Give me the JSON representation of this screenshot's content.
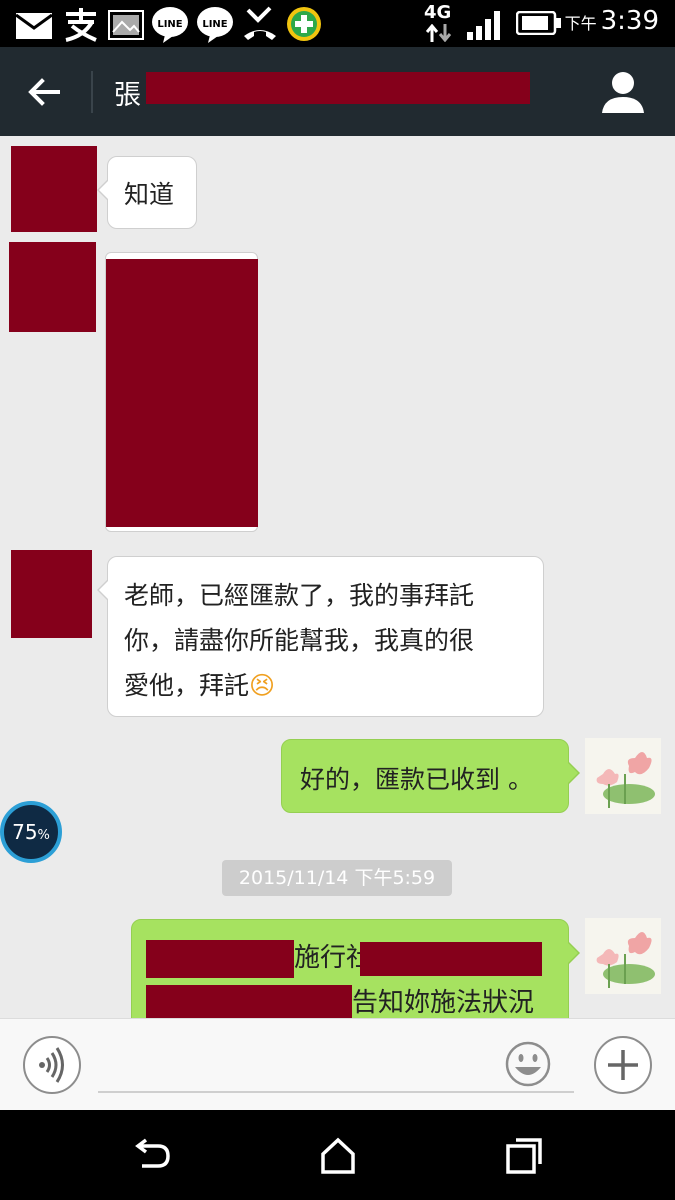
{
  "status_bar": {
    "network": "4G",
    "ampm": "下午",
    "time": "3:39",
    "icons": [
      "mail-icon",
      "alipay-icon",
      "image-icon",
      "line-icon",
      "line-icon",
      "missed-call-icon",
      "plus-app-icon",
      "signal-icon",
      "battery-icon"
    ]
  },
  "toolbar": {
    "title": "張",
    "back_icon": "arrow-left-icon",
    "profile_icon": "person-icon"
  },
  "messages": [
    {
      "side": "in",
      "type": "text",
      "text": "知道"
    },
    {
      "side": "in",
      "type": "image"
    },
    {
      "side": "in",
      "type": "text",
      "lines": [
        "老師，已經匯款了，我的事拜託",
        "你，請盡你所能幫我，我真的很",
        "愛他，拜託"
      ],
      "emoji": "😣"
    },
    {
      "side": "out",
      "type": "text",
      "text": "好的，匯款已收到 。"
    },
    {
      "side": "out",
      "type": "text",
      "lines": [
        "施行社",
        "告知妳施法狀況"
      ]
    }
  ],
  "timestamp": "2015/11/14 下午5:59",
  "badge": {
    "value": "75",
    "unit": "%"
  },
  "input": {
    "placeholder": ""
  },
  "colors": {
    "toolbar": "#212a30",
    "chat_bg": "#ebebeb",
    "out_bubble": "#a6e260",
    "redaction": "#85001b"
  }
}
